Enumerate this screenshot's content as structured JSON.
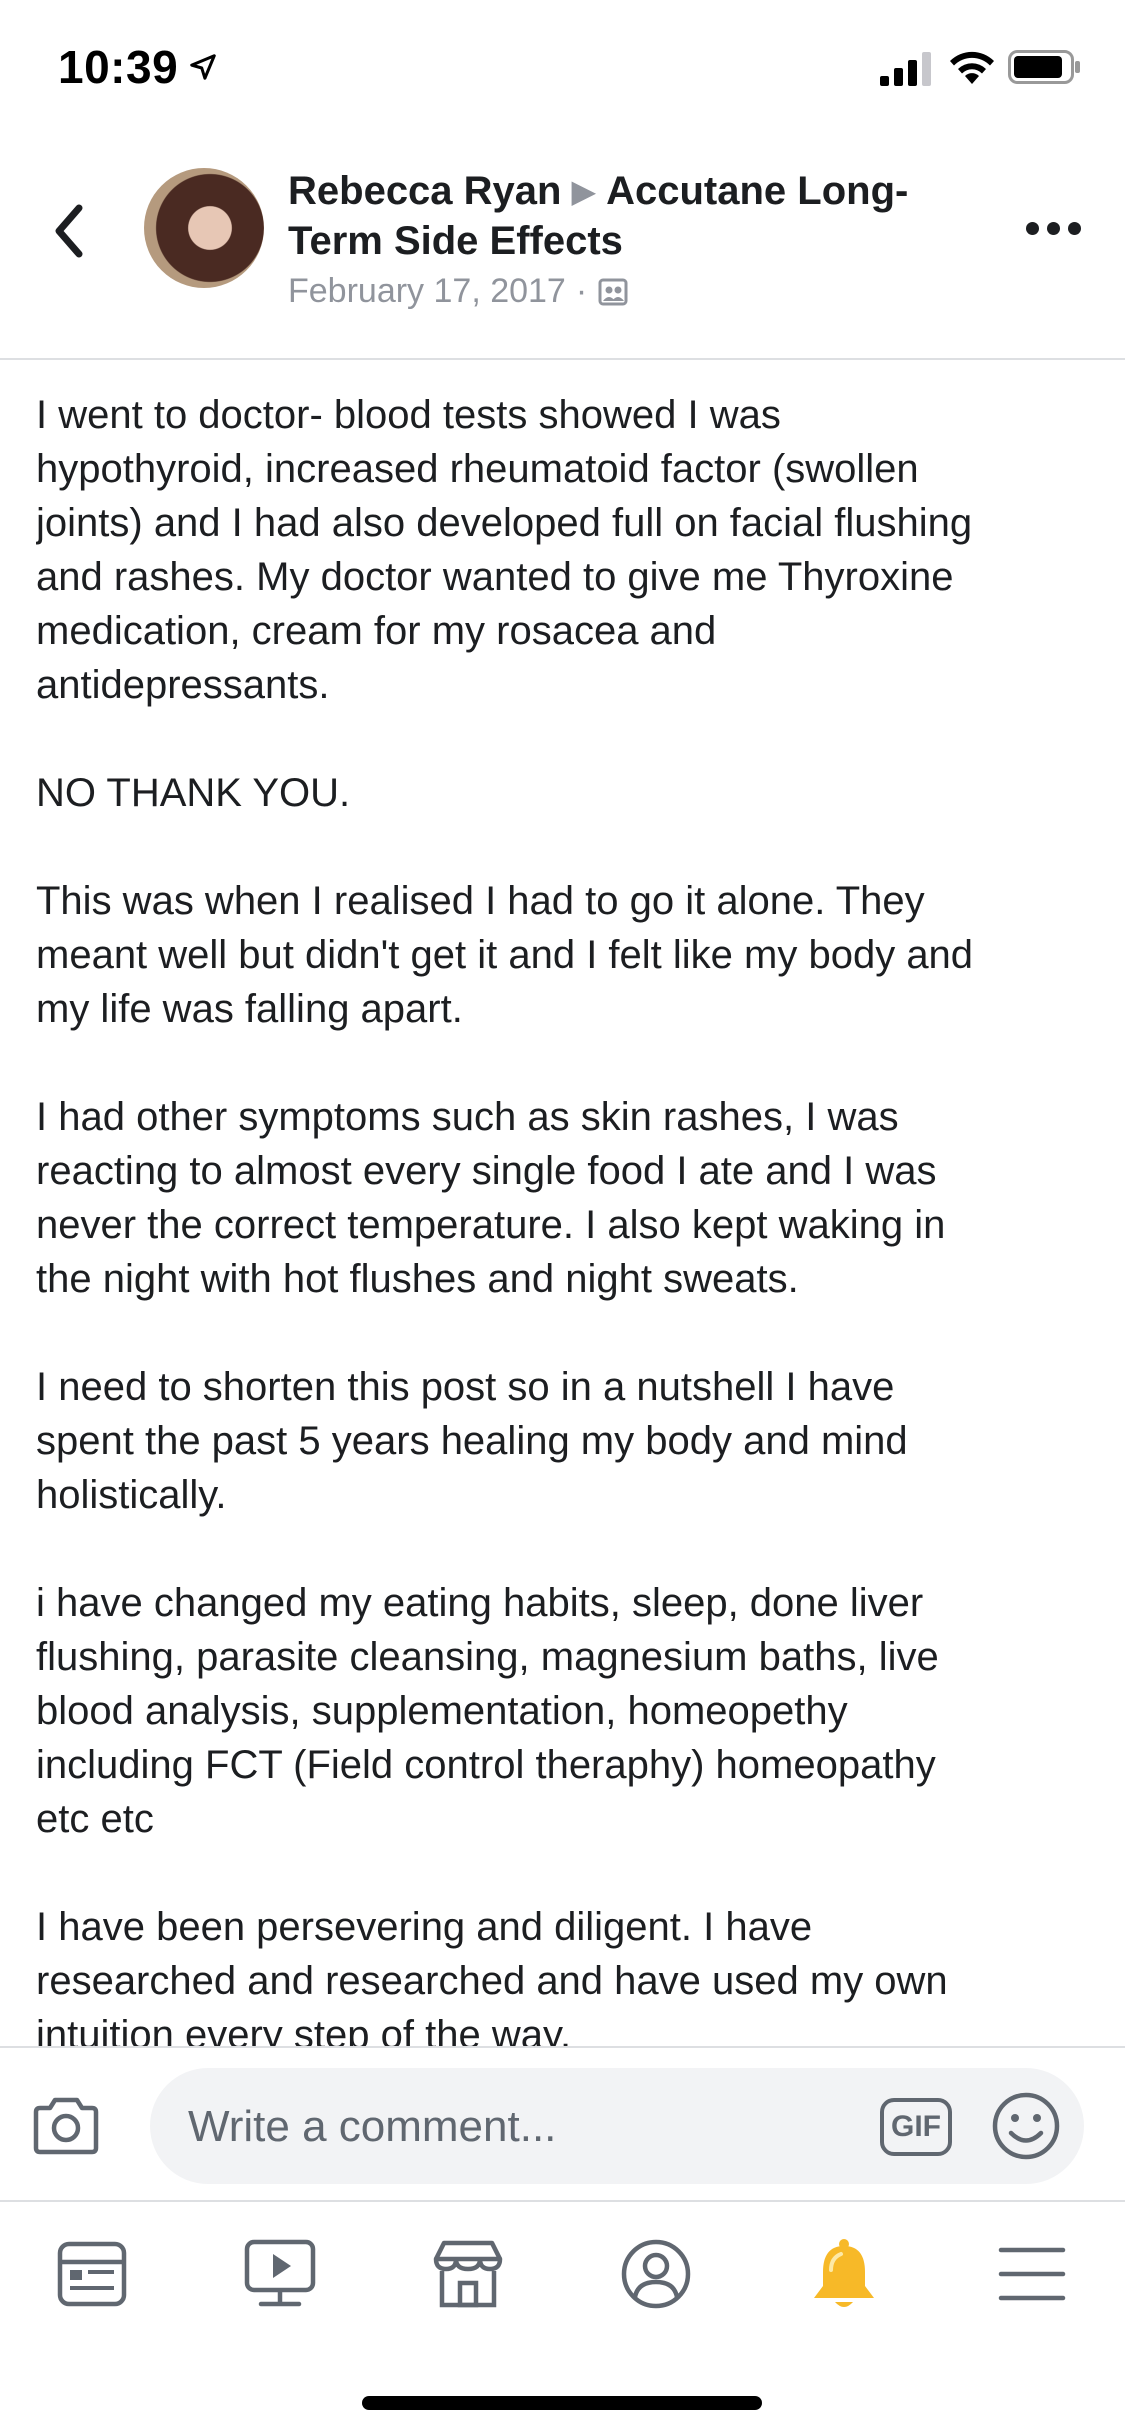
{
  "status_bar": {
    "time": "10:39"
  },
  "header": {
    "author": "Rebecca Ryan",
    "group": "Accutane Long-Term Side Effects",
    "date": "February 17, 2017",
    "separator": "·"
  },
  "post": {
    "paragraphs": [
      "I went to doctor- blood tests showed I was\nhypothyroid, increased rheumatoid factor (swollen\njoints) and I had also developed full on facial flushing\nand rashes. My doctor wanted to give me Thyroxine\nmedication, cream for my rosacea and\nantidepressants.",
      "NO THANK YOU.",
      "This was when I realised I had to go it alone. They\nmeant well but didn't get it and I felt like my body and\nmy life was falling apart.",
      "I had other symptoms such as skin rashes, I was\nreacting to almost every single food I ate and I was\nnever the correct temperature. I also kept waking in\nthe night with hot flushes and night sweats.",
      "I need to shorten this post so in a nutshell I have\nspent the past 5 years healing my body and mind\nholistically.",
      "i have changed my eating habits, sleep, done liver\nflushing, parasite cleansing, magnesium baths, live\nblood analysis, supplementation, homeopethy\nincluding FCT (Field control theraphy) homeopathy\netc etc",
      "I have been persevering and diligent. I have\nresearched and researched and have used my own\nintuition every step of the way."
    ]
  },
  "comment_bar": {
    "placeholder": "Write a comment...",
    "gif_label": "GIF"
  },
  "colors": {
    "text": "#1c1e21",
    "secondary": "#90949c",
    "field_bg": "#f2f3f5",
    "notification_bell": "#f7b928"
  },
  "tabs": [
    {
      "icon": "news-feed-icon"
    },
    {
      "icon": "watch-video-icon"
    },
    {
      "icon": "marketplace-icon"
    },
    {
      "icon": "profile-icon"
    },
    {
      "icon": "notifications-bell-icon"
    },
    {
      "icon": "menu-icon"
    }
  ]
}
